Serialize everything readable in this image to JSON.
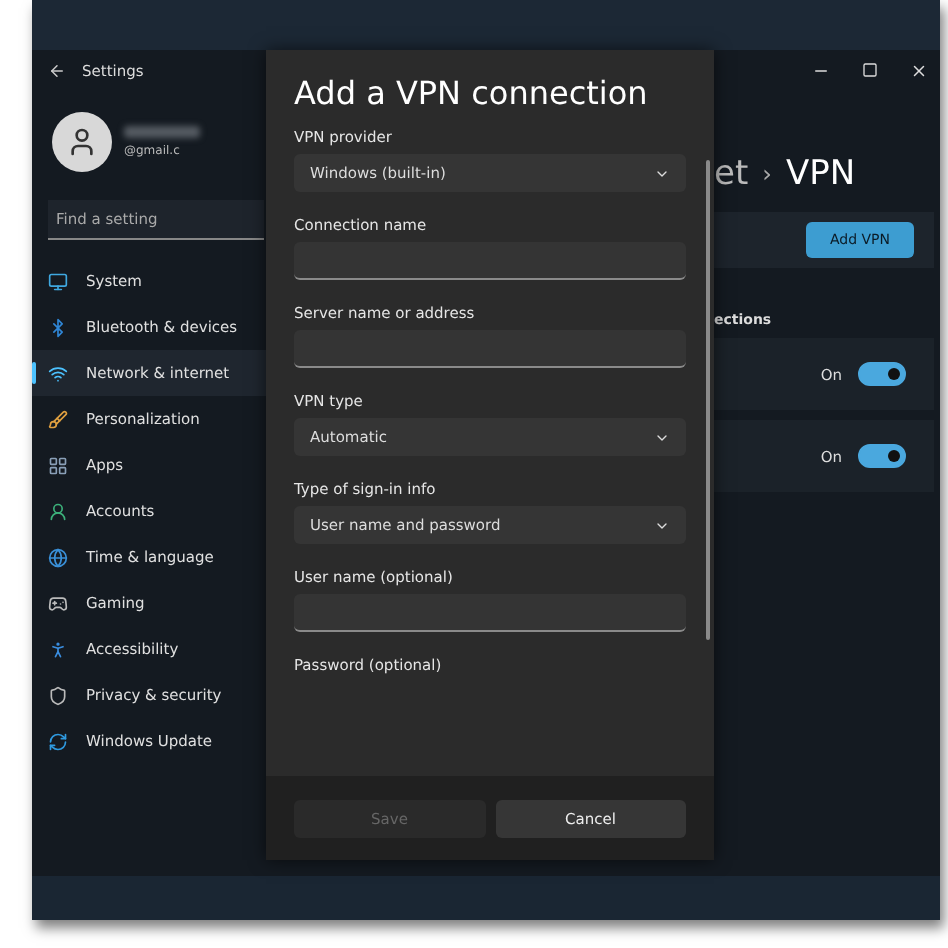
{
  "window": {
    "title": "Settings"
  },
  "account": {
    "email": "@gmail.c"
  },
  "search": {
    "placeholder": "Find a setting"
  },
  "nav": [
    {
      "label": "System",
      "selected": false
    },
    {
      "label": "Bluetooth & devices",
      "selected": false
    },
    {
      "label": "Network & internet",
      "selected": true
    },
    {
      "label": "Personalization",
      "selected": false
    },
    {
      "label": "Apps",
      "selected": false
    },
    {
      "label": "Accounts",
      "selected": false
    },
    {
      "label": "Time & language",
      "selected": false
    },
    {
      "label": "Gaming",
      "selected": false
    },
    {
      "label": "Accessibility",
      "selected": false
    },
    {
      "label": "Privacy & security",
      "selected": false
    },
    {
      "label": "Windows Update",
      "selected": false
    }
  ],
  "page": {
    "breadcrumb_fragment": "et",
    "separator": "›",
    "title": "VPN",
    "add_button": "Add VPN",
    "section": "ections",
    "connections": [
      {
        "status": "On",
        "on": true
      },
      {
        "status": "On",
        "on": true
      }
    ]
  },
  "dialog": {
    "title": "Add a VPN connection",
    "fields": [
      {
        "kind": "dropdown",
        "label": "VPN provider",
        "value": "Windows (built-in)"
      },
      {
        "kind": "text",
        "label": "Connection name"
      },
      {
        "kind": "text",
        "label": "Server name or address"
      },
      {
        "kind": "dropdown",
        "label": "VPN type",
        "value": "Automatic"
      },
      {
        "kind": "dropdown",
        "label": "Type of sign-in info",
        "value": "User name and password"
      },
      {
        "kind": "text",
        "label": "User name (optional)"
      },
      {
        "kind": "label",
        "label": "Password (optional)"
      }
    ],
    "buttons": [
      {
        "label": "Save",
        "disabled": true
      },
      {
        "label": "Cancel",
        "disabled": false
      }
    ]
  }
}
